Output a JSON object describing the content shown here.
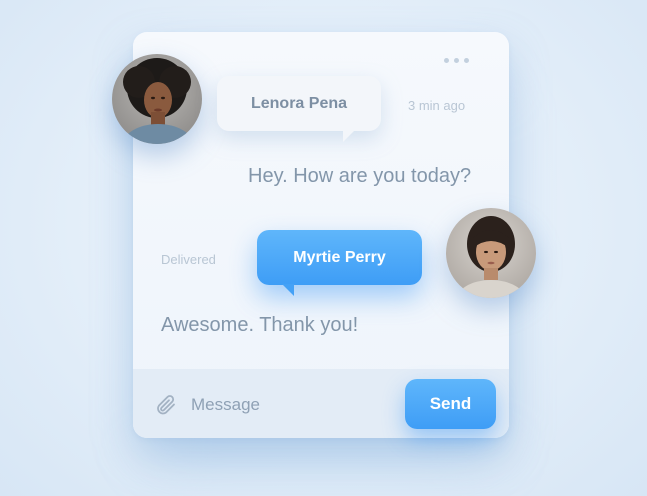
{
  "header": {
    "more_icon": "more-horizontal-icon"
  },
  "conversation": {
    "incoming": {
      "sender_name": "Lenora Pena",
      "timestamp": "3 min ago",
      "message": "Hey. How are you today?",
      "avatar": "avatar-lenora-pena"
    },
    "outgoing": {
      "sender_name": "Myrtie Perry",
      "status": "Delivered",
      "message": "Awesome. Thank you!",
      "avatar": "avatar-myrtie-perry"
    }
  },
  "composer": {
    "attach_icon": "paperclip-icon",
    "placeholder": "Message",
    "value": "",
    "send_label": "Send"
  },
  "colors": {
    "accent": "#3e9df6",
    "accent_light": "#5fb6fb",
    "text_muted": "#8396aa",
    "text_faint": "#b9c6d4",
    "card_bg": "#f3f7fc",
    "page_bg": "#e3eef9"
  }
}
